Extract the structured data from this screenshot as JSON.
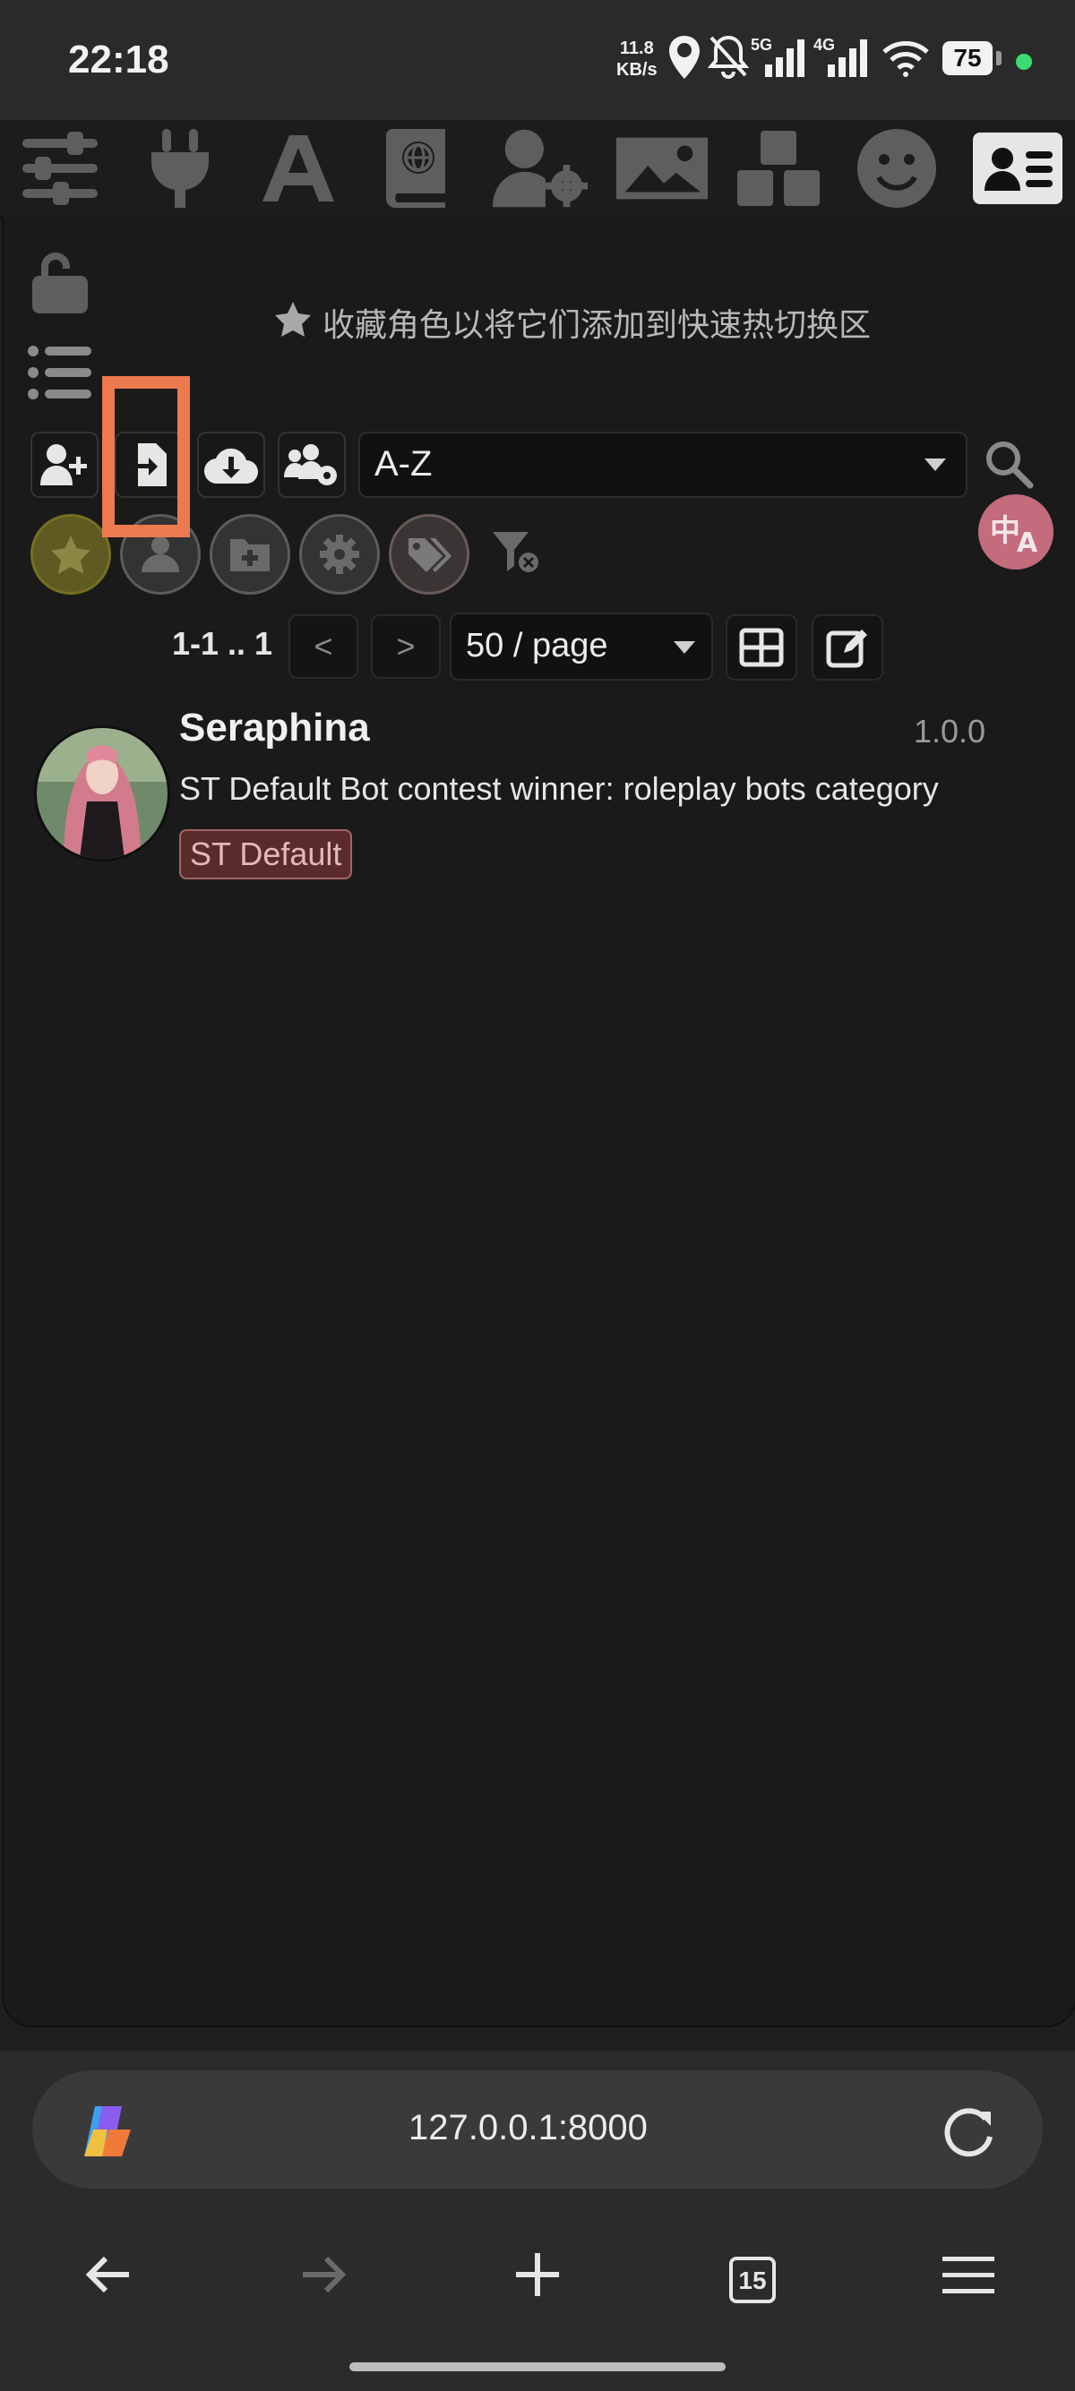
{
  "status_bar": {
    "time": "22:18",
    "net_speed_value": "11.8",
    "net_speed_unit": "KB/s",
    "signal_1": "5G",
    "signal_2": "4G",
    "battery": "75"
  },
  "top_toolbar": {
    "icons": [
      "sliders-icon",
      "plug-icon",
      "font-icon",
      "book-globe-icon",
      "user-gear-icon",
      "image-icon",
      "cubes-icon",
      "smile-icon",
      "character-card-icon"
    ],
    "active": "character-card-icon"
  },
  "panel": {
    "favorites_hint": "收藏角色以将它们添加到快速热切换区",
    "sort": {
      "value": "A-Z"
    },
    "pagination": {
      "info": "1-1 .. 1",
      "prev": "<",
      "next": ">",
      "per_page": "50 / page"
    },
    "character": {
      "name": "Seraphina",
      "version": "1.0.0",
      "description": "ST Default Bot contest winner: roleplay bots category",
      "tag": "ST Default"
    }
  },
  "browser": {
    "url": "127.0.0.1:8000",
    "tab_count": "15"
  },
  "colors": {
    "highlight": "#ec7a4e",
    "translate_badge": "#c46b7e",
    "tag_bg": "#5a2b2b",
    "fav_circle": "#6b6526"
  }
}
